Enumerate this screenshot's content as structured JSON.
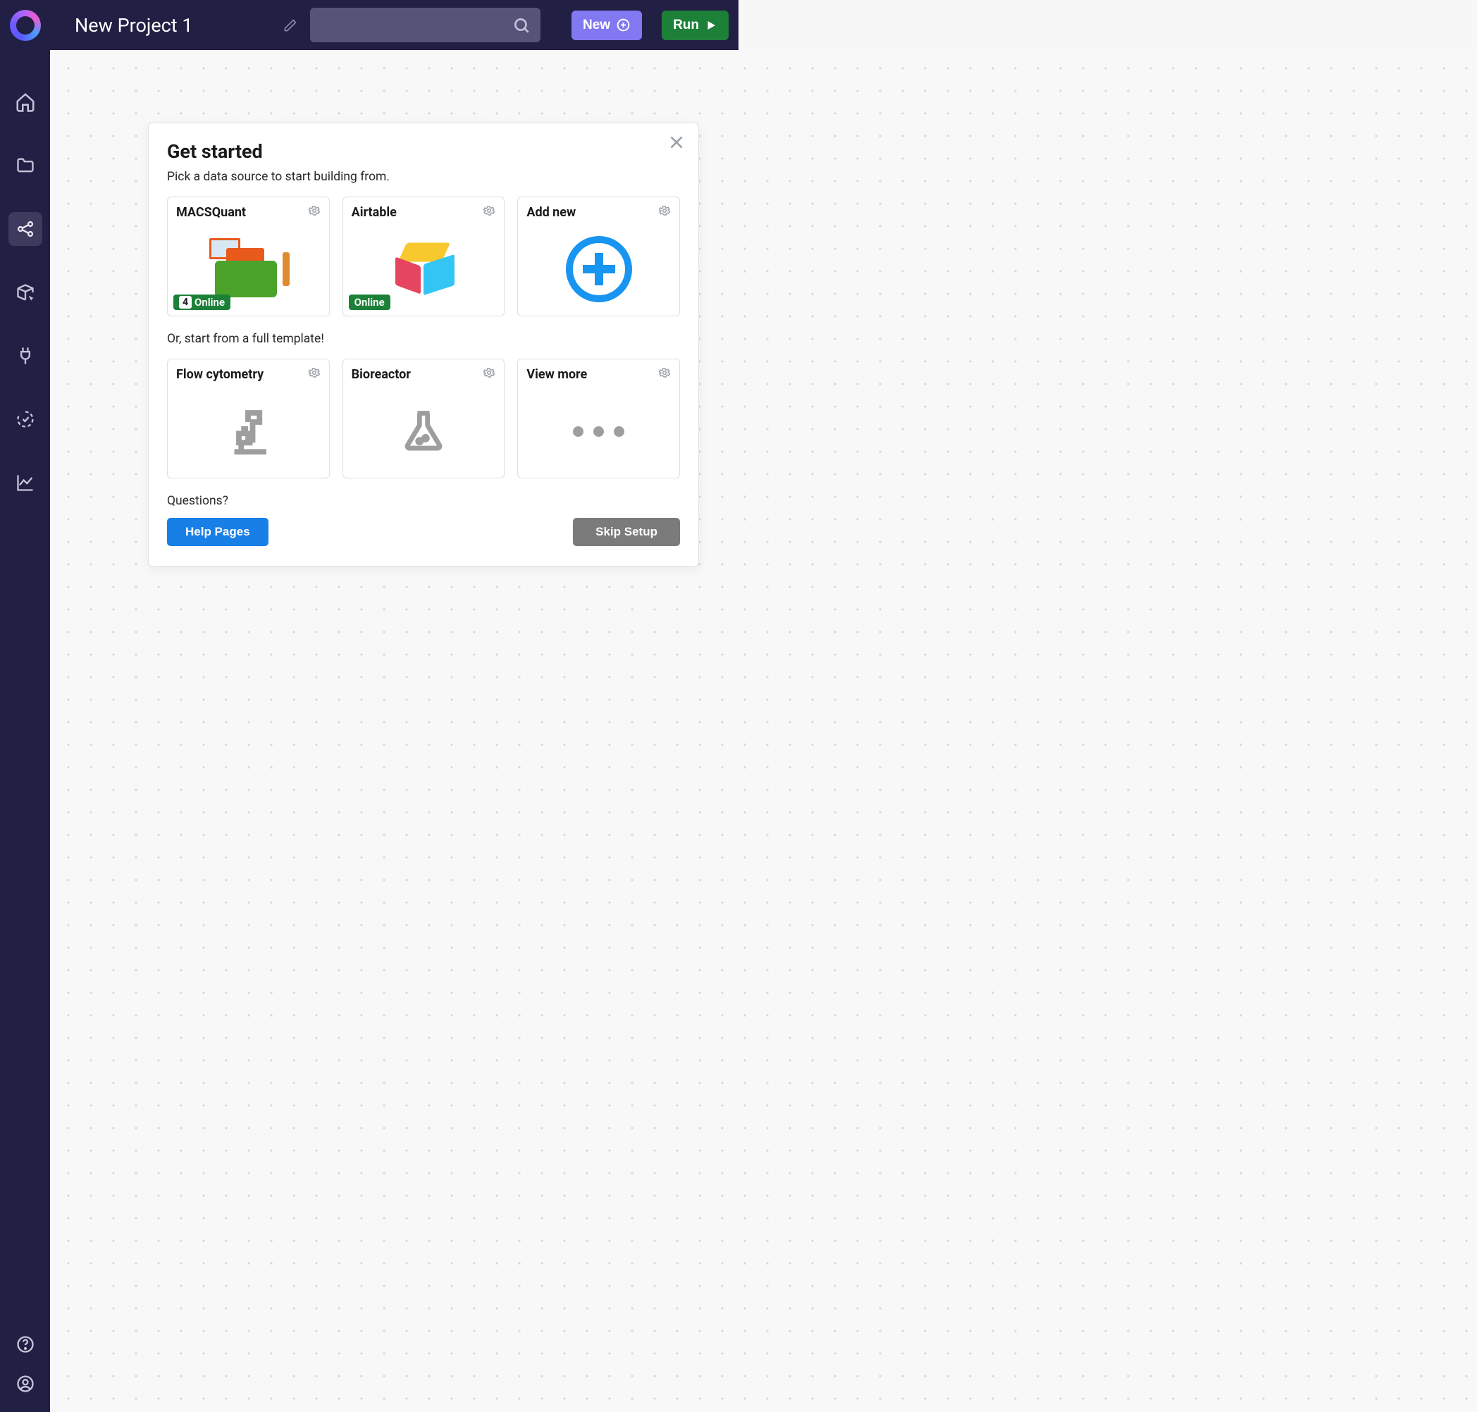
{
  "header": {
    "project_title": "New Project 1",
    "search_placeholder": "",
    "new_label": "New",
    "run_label": "Run"
  },
  "sidebar": {
    "items": [
      {
        "name": "home"
      },
      {
        "name": "folder"
      },
      {
        "name": "graph"
      },
      {
        "name": "box-cursor"
      },
      {
        "name": "plug"
      },
      {
        "name": "progress"
      },
      {
        "name": "chart"
      }
    ],
    "bottom": [
      {
        "name": "help"
      },
      {
        "name": "user"
      }
    ]
  },
  "modal": {
    "title": "Get started",
    "subtitle": "Pick a data source to start building from.",
    "datasources": [
      {
        "title": "MACSQuant",
        "status_count": "4",
        "status_text": "Online"
      },
      {
        "title": "Airtable",
        "status_text": "Online"
      },
      {
        "title": "Add new"
      }
    ],
    "template_label": "Or, start from a full template!",
    "templates": [
      {
        "title": "Flow cytometry"
      },
      {
        "title": "Bioreactor"
      },
      {
        "title": "View more"
      }
    ],
    "questions_label": "Questions?",
    "help_button": "Help Pages",
    "skip_button": "Skip Setup"
  }
}
